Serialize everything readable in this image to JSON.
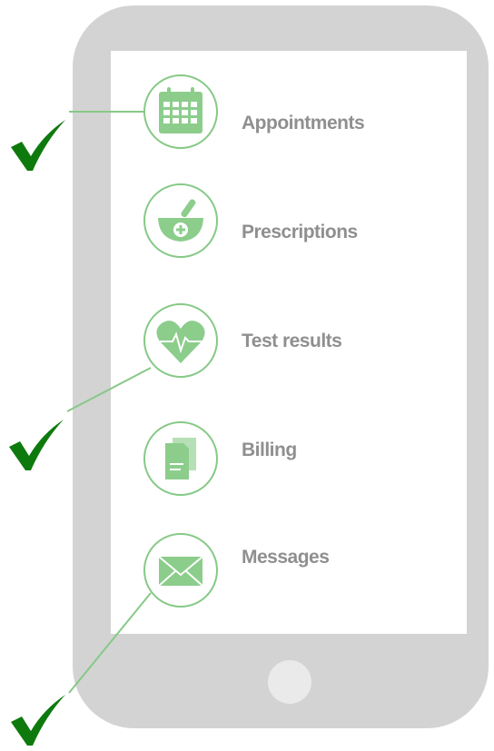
{
  "features": [
    {
      "label": "Appointments",
      "icon": "calendar-icon",
      "checked": true
    },
    {
      "label": "Prescriptions",
      "icon": "mortar-pestle-icon",
      "checked": false
    },
    {
      "label": "Test results",
      "icon": "heart-pulse-icon",
      "checked": true
    },
    {
      "label": "Billing",
      "icon": "documents-icon",
      "checked": false
    },
    {
      "label": "Messages",
      "icon": "envelope-icon",
      "checked": true
    }
  ],
  "colors": {
    "icon_green": "#8ccd8c",
    "ring_green": "#86c986",
    "check_green": "#0e7a0e",
    "label_gray": "#8f8f8f",
    "phone_gray": "#d3d3d3"
  }
}
